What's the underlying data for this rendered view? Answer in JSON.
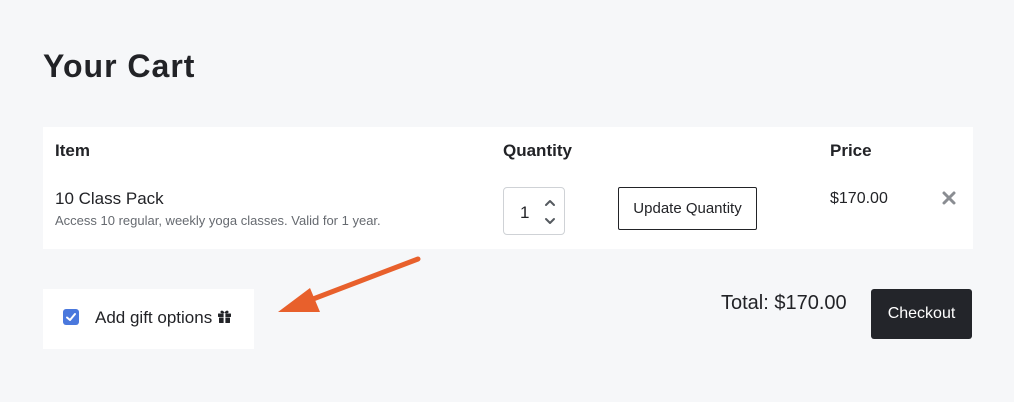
{
  "page": {
    "title": "Your Cart"
  },
  "table": {
    "headers": {
      "item": "Item",
      "quantity": "Quantity",
      "price": "Price"
    },
    "rows": [
      {
        "name": "10 Class Pack",
        "description": "Access 10 regular, weekly yoga classes. Valid for 1 year.",
        "quantity": "1",
        "update_label": "Update Quantity",
        "price": "$170.00",
        "remove_icon": "close-icon"
      }
    ]
  },
  "gift": {
    "label": "Add gift options",
    "checked": true,
    "icon": "gift-icon"
  },
  "summary": {
    "total": "Total: $170.00",
    "checkout_label": "Checkout"
  },
  "colors": {
    "accent": "#4a78dd",
    "annotation_arrow": "#e8602c",
    "dark": "#23252a"
  }
}
